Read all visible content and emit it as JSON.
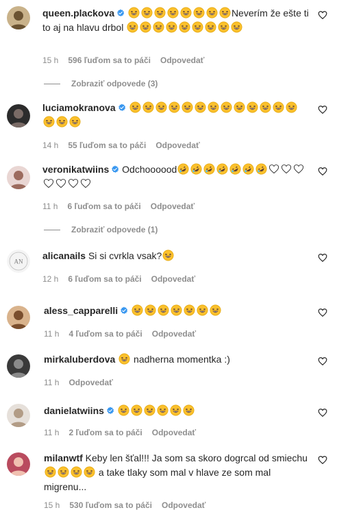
{
  "comments": [
    {
      "username": "queen.plackova",
      "verified": true,
      "segments": [
        {
          "e": 8
        },
        {
          "t": "Neverím že ešte ti to aj na hlavu drbol "
        },
        {
          "e": 9
        }
      ],
      "time": "15 h",
      "likes": "596 ľuďom sa to páči",
      "reply": "Odpovedať",
      "view_replies": "Zobraziť odpovede (3)",
      "avatar": "avatar-1"
    },
    {
      "username": "luciamokranova",
      "verified": true,
      "segments": [
        {
          "e": 16
        }
      ],
      "time": "14 h",
      "likes": "55 ľuďom sa to páči",
      "reply": "Odpovedať",
      "avatar": "avatar-2"
    },
    {
      "username": "veronikatwiins",
      "verified": true,
      "segments": [
        {
          "t": "Odchoooood"
        },
        {
          "r": 7
        },
        {
          "h": 7
        }
      ],
      "time": "11 h",
      "likes": "6 ľuďom sa to páči",
      "reply": "Odpovedať",
      "view_replies": "Zobraziť odpovede (1)",
      "avatar": "avatar-3"
    },
    {
      "username": "alicanails",
      "verified": false,
      "segments": [
        {
          "t": "Si si cvrkla vsak?"
        },
        {
          "e": 1
        }
      ],
      "time": "12 h",
      "likes": "6 ľuďom sa to páči",
      "reply": "Odpovedať",
      "avatar": "avatar-4"
    },
    {
      "username": "aless_capparelli",
      "verified": true,
      "segments": [
        {
          "e": 7
        }
      ],
      "time": "11 h",
      "likes": "4 ľuďom sa to páči",
      "reply": "Odpovedať",
      "avatar": "avatar-5"
    },
    {
      "username": "mirkaluberdova",
      "verified": false,
      "segments": [
        {
          "e": 1
        },
        {
          "t": " nadherna momentka :)"
        }
      ],
      "time": "11 h",
      "reply": "Odpovedať",
      "avatar": "avatar-6"
    },
    {
      "username": "danielatwiins",
      "verified": true,
      "segments": [
        {
          "e": 6
        }
      ],
      "time": "11 h",
      "likes": "2 ľuďom sa to páči",
      "reply": "Odpovedať",
      "avatar": "avatar-7"
    },
    {
      "username": "milanwtf",
      "verified": false,
      "segments": [
        {
          "t": "Keby len šťal!!! Ja som sa skoro dogrcal od smiechu "
        },
        {
          "e": 4
        },
        {
          "t": " a take tlaky som mal v hlave ze som mal migrenu..."
        }
      ],
      "time": "15 h",
      "likes": "530 ľuďom sa to páči",
      "reply": "Odpovedať",
      "avatar": "avatar-8"
    }
  ],
  "colors": {
    "verified": "#3897f0",
    "meta": "#8e8e8e",
    "text": "#262626",
    "emoji": "#fbc02d",
    "heart_outline": "#262626"
  }
}
